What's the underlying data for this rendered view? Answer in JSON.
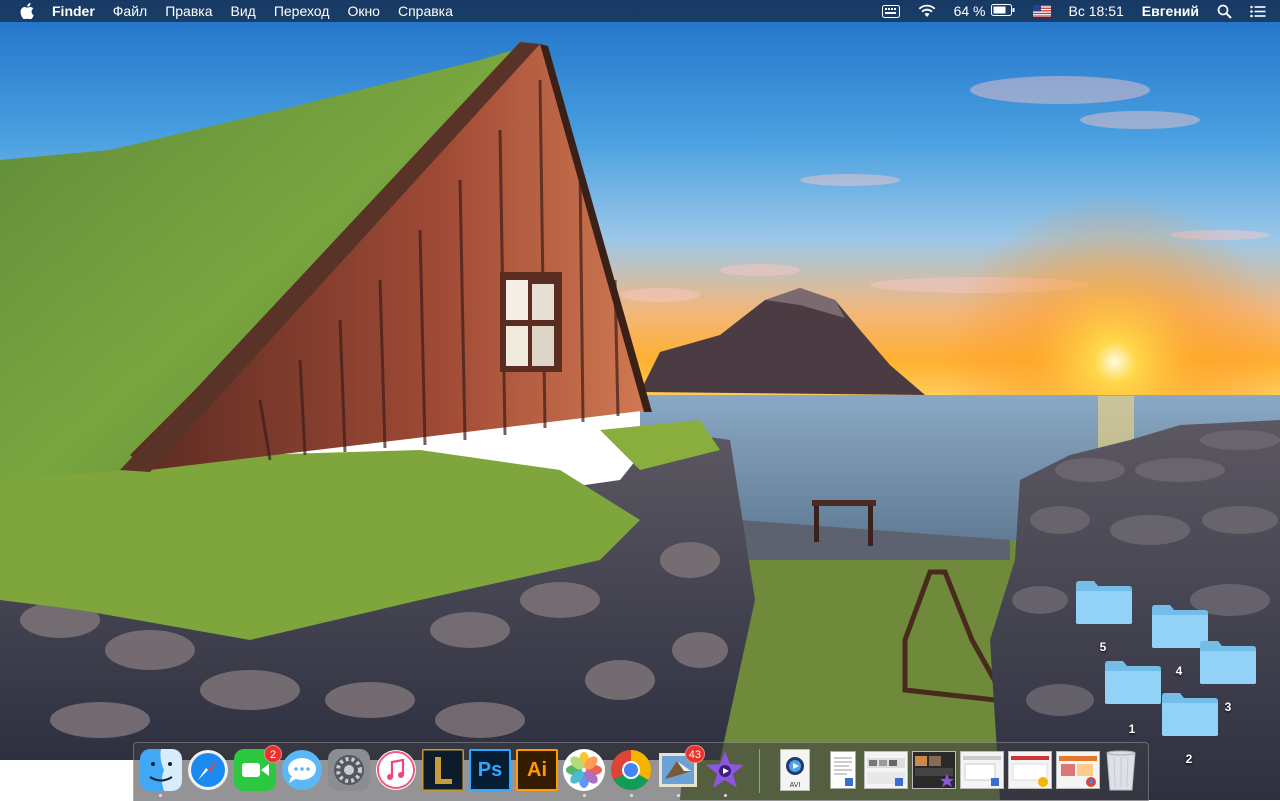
{
  "menubar": {
    "app_name": "Finder",
    "items": [
      "Файл",
      "Правка",
      "Вид",
      "Переход",
      "Окно",
      "Справка"
    ],
    "battery_percent": "64 %",
    "clock": "Вс 18:51",
    "user": "Евгений"
  },
  "desktop": {
    "folders": [
      {
        "label": "5"
      },
      {
        "label": "4"
      },
      {
        "label": "3"
      },
      {
        "label": "1"
      },
      {
        "label": "2"
      }
    ]
  },
  "dock": {
    "apps": [
      {
        "name": "finder-icon",
        "running": true
      },
      {
        "name": "safari-icon",
        "running": false
      },
      {
        "name": "facetime-icon",
        "badge": "2",
        "running": false
      },
      {
        "name": "messages-icon",
        "running": false
      },
      {
        "name": "system-preferences-icon",
        "running": false
      },
      {
        "name": "itunes-icon",
        "running": false
      },
      {
        "name": "league-of-legends-icon",
        "running": false
      },
      {
        "name": "photoshop-icon",
        "label": "Ps",
        "running": false
      },
      {
        "name": "illustrator-icon",
        "label": "Ai",
        "running": false
      },
      {
        "name": "photos-icon",
        "running": true
      },
      {
        "name": "chrome-icon",
        "running": true
      },
      {
        "name": "mail-icon",
        "badge": "43",
        "running": true
      },
      {
        "name": "imovie-icon",
        "running": true
      }
    ],
    "file_label": "AVI"
  },
  "colors": {
    "folder": "#8fd0f5",
    "badge": "#e8322c",
    "photoshop": "#31a8ff",
    "illustrator": "#ff9a00"
  }
}
